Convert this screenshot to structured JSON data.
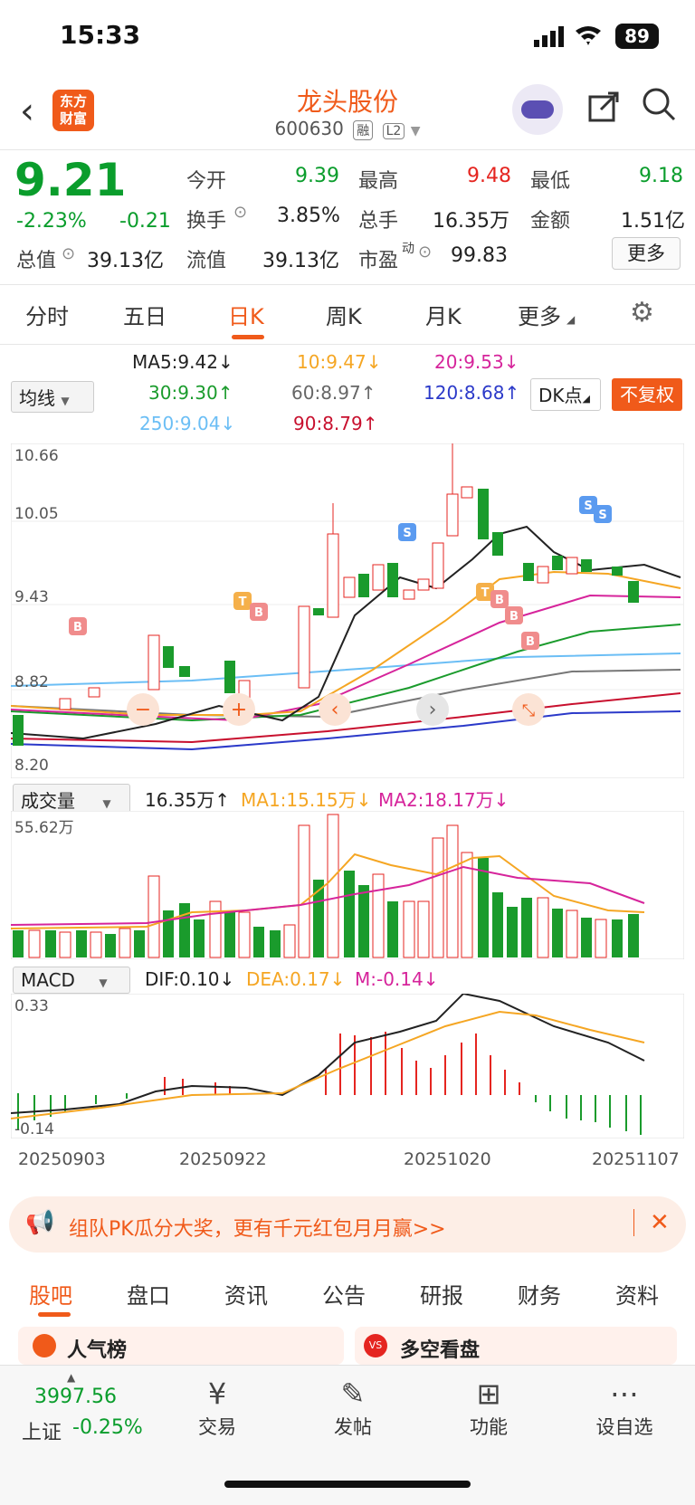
{
  "status": {
    "time": "15:33",
    "battery": "89"
  },
  "header": {
    "logo_line1": "东方",
    "logo_line2": "财富",
    "stock_name": "龙头股份",
    "stock_code": "600630",
    "tag_margin": "融",
    "tag_level": "L2"
  },
  "quote": {
    "price": "9.21",
    "change_pct": "-2.23%",
    "change": "-0.21",
    "open_label": "今开",
    "open": "9.39",
    "high_label": "最高",
    "high": "9.48",
    "low_label": "最低",
    "low": "9.18",
    "turnover_label": "换手",
    "turnover": "3.85%",
    "volume_label": "总手",
    "volume": "16.35万",
    "amount_label": "金额",
    "amount": "1.51亿",
    "mktcap_label": "总值",
    "mktcap": "39.13亿",
    "float_label": "流值",
    "float": "39.13亿",
    "pe_label": "市盈",
    "pe_sup": "动",
    "pe": "99.83",
    "more_label": "更多"
  },
  "tabs": [
    "分时",
    "五日",
    "日K",
    "周K",
    "月K",
    "更多"
  ],
  "active_tab": "日K",
  "ma": {
    "select_label": "均线",
    "ma5": "MA5:9.42",
    "ma10": "10:9.47",
    "ma20": "20:9.53",
    "ma30": "30:9.30",
    "ma60": "60:8.97",
    "ma120": "120:8.68",
    "ma250": "250:9.04",
    "ma90": "90:8.79",
    "dk_label": "DK点",
    "fq_label": "不复权"
  },
  "kline_axis": [
    "10.66",
    "10.05",
    "9.43",
    "8.82",
    "8.20"
  ],
  "volume": {
    "select_label": "成交量",
    "vol": "16.35万",
    "ma1": "MA1:15.15万",
    "ma2": "MA2:18.17万",
    "axis_top": "55.62万"
  },
  "macd": {
    "select_label": "MACD",
    "dif": "DIF:0.10",
    "dea": "DEA:0.17",
    "m": "M:-0.14",
    "axis_top": "0.33",
    "axis_bottom": "-0.14"
  },
  "dates": [
    "20250903",
    "20250922",
    "20251020",
    "20251107"
  ],
  "banner": {
    "text": "组队PK瓜分大奖，更有千元红包月月赢>>"
  },
  "bottom_tabs": [
    "股吧",
    "盘口",
    "资讯",
    "公告",
    "研报",
    "财务",
    "资料"
  ],
  "sections": {
    "left": "人气榜",
    "right": "多空看盘"
  },
  "index": {
    "value": "3997.56",
    "name": "上证",
    "change": "-0.25%"
  },
  "bottom_nav": [
    "交易",
    "发帖",
    "功能",
    "设自选"
  ],
  "colors": {
    "accent": "#f05a1a",
    "up": "#e52520",
    "down": "#0a9d2c"
  }
}
